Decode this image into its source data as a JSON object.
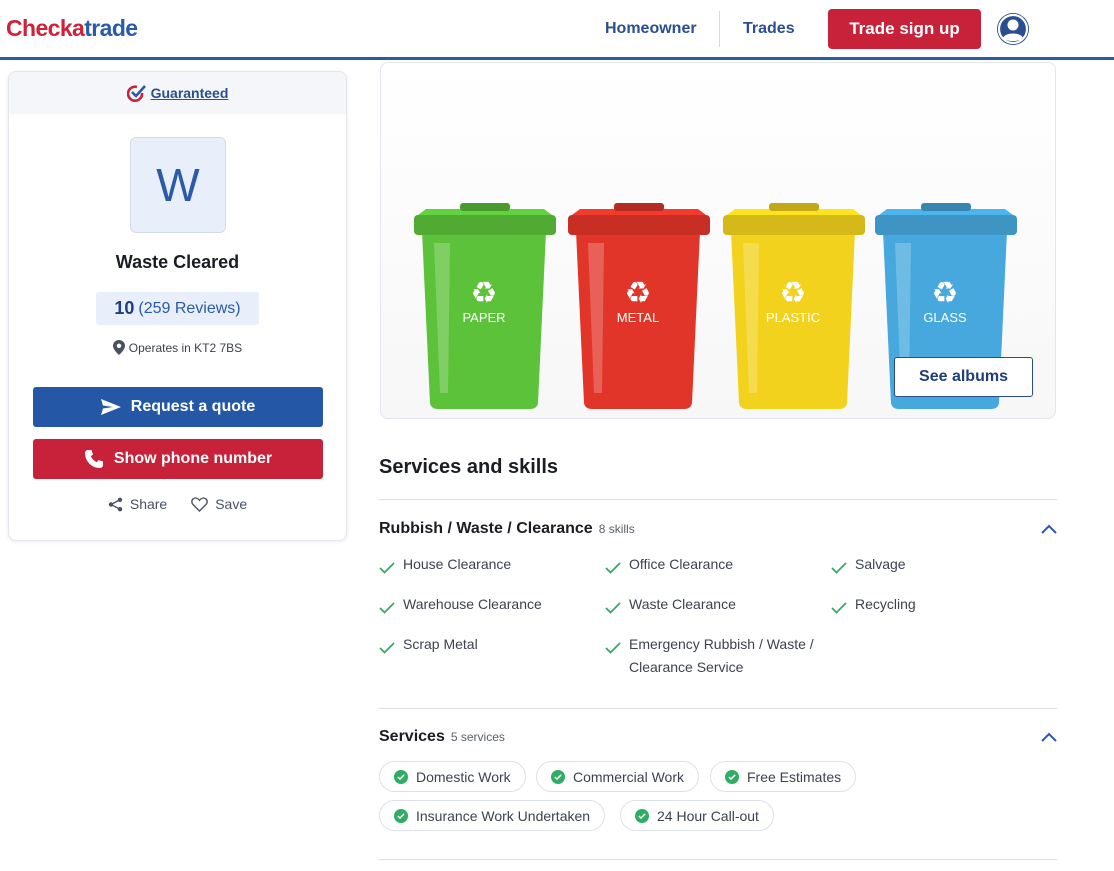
{
  "header": {
    "logo_part1": "Check",
    "logo_part2": "a",
    "logo_part3": "trade",
    "nav": [
      "Homeowner",
      "Trades"
    ],
    "signup_label": "Trade sign up",
    "account_icon": "account-icon"
  },
  "profile": {
    "guaranteed_label": "Guaranteed",
    "avatar_letter": "W",
    "name": "Waste Cleared",
    "score": "10",
    "reviews": "(259 Reviews)",
    "location": "Operates in KT2 7BS",
    "quote_label": "Request a quote",
    "phone_label": "Show phone number",
    "share_label": "Share",
    "save_label": "Save"
  },
  "hero": {
    "bins": [
      {
        "label": "PAPER",
        "color": "#5cc23a"
      },
      {
        "label": "METAL",
        "color": "#e2352a"
      },
      {
        "label": "PLASTIC",
        "color": "#f2d21c"
      },
      {
        "label": "GLASS",
        "color": "#46a8dc"
      }
    ],
    "albums_label": "See albums"
  },
  "services_section": {
    "title": "Services and skills",
    "skills_group": {
      "title": "Rubbish / Waste / Clearance",
      "count": "8 skills",
      "items": [
        "House Clearance",
        "Office Clearance",
        "Salvage",
        "Warehouse Clearance",
        "Waste Clearance",
        "Recycling",
        "Scrap Metal",
        "Emergency Rubbish / Waste / Clearance Service"
      ]
    },
    "services_group": {
      "title": "Services",
      "count": "5 services",
      "items": [
        "Domestic Work",
        "Commercial Work",
        "Free Estimates",
        "Insurance Work Undertaken",
        "24 Hour Call-out"
      ]
    }
  },
  "colors": {
    "brand_blue": "#2a5aa8",
    "brand_red": "#c8213a",
    "check_green": "#2fad62"
  }
}
